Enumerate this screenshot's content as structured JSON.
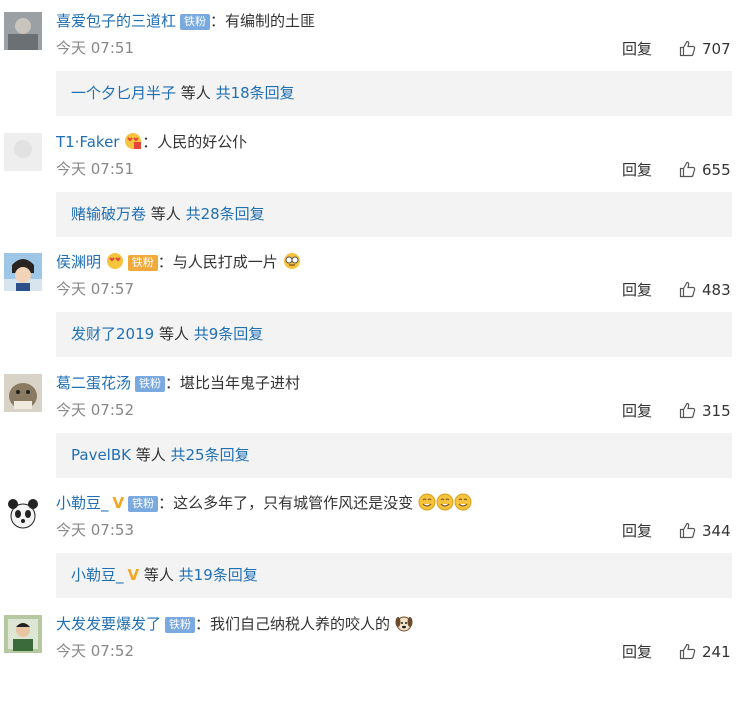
{
  "comments": [
    {
      "user": "喜爱包子的三道杠",
      "badge": "铁粉",
      "text": "：有编制的土匪",
      "time": "今天 07:51",
      "reply_label": "回复",
      "likes": "707",
      "replies": {
        "users": "一个夕匕月半子",
        "mid": " 等人 ",
        "count": "共18条回复"
      }
    },
    {
      "user": "T1·Faker",
      "badge": "",
      "text": "：人民的好公仆",
      "time": "今天 07:51",
      "reply_label": "回复",
      "likes": "655",
      "replies": {
        "users": "赌输破万卷",
        "mid": " 等人 ",
        "count": "共28条回复"
      }
    },
    {
      "user": "侯渊明",
      "badge": "铁粉",
      "text": "：与人民打成一片",
      "time": "今天 07:57",
      "reply_label": "回复",
      "likes": "483",
      "replies": {
        "users": "发财了2019",
        "mid": " 等人 ",
        "count": "共9条回复"
      }
    },
    {
      "user": "葛二蛋花汤",
      "badge": "铁粉",
      "text": "：堪比当年鬼子进村",
      "time": "今天 07:52",
      "reply_label": "回复",
      "likes": "315",
      "replies": {
        "users": "PavelBK",
        "mid": " 等人 ",
        "count": "共25条回复"
      }
    },
    {
      "user": "小勒豆_",
      "badge": "铁粉",
      "text": "：这么多年了，只有城管作风还是没变",
      "time": "今天 07:53",
      "reply_label": "回复",
      "likes": "344",
      "replies": {
        "users": "小勒豆_",
        "mid": " 等人 ",
        "count": "共19条回复"
      }
    },
    {
      "user": "大发发要爆发了",
      "badge": "铁粉",
      "text": "：我们自己纳税人养的咬人的",
      "time": "今天 07:52",
      "reply_label": "回复",
      "likes": "241"
    }
  ],
  "colors": {
    "username": "#1f6fb5",
    "badge": "#7aa9df",
    "reply_bg": "#f3f3f3",
    "v_mark": "#f5a623"
  }
}
